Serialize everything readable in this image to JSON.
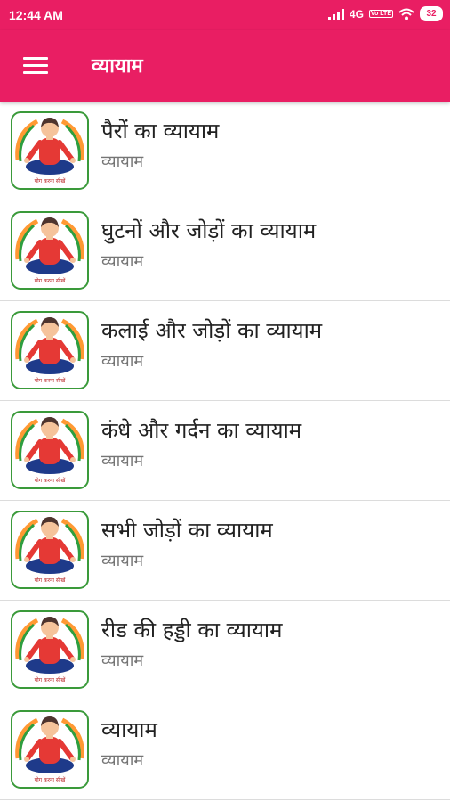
{
  "status_bar": {
    "time": "12:44 AM",
    "network": "4G",
    "volte": "Vo LTE",
    "battery": "32"
  },
  "app_bar": {
    "menu_icon": "hamburger-menu-icon",
    "title": "व्यायाम"
  },
  "thumbnail": {
    "caption": "योग करना सीखें",
    "icon": "yoga-pose-icon"
  },
  "items": [
    {
      "title": "पैरों का व्यायाम",
      "subtitle": "व्यायाम"
    },
    {
      "title": "घुटनों और जोड़ों का व्यायाम",
      "subtitle": "व्यायाम"
    },
    {
      "title": "कलाई और जोड़ों का व्यायाम",
      "subtitle": "व्यायाम"
    },
    {
      "title": "कंधे और गर्दन का व्यायाम",
      "subtitle": "व्यायाम"
    },
    {
      "title": "सभी जोड़ों का व्यायाम",
      "subtitle": "व्यायाम"
    },
    {
      "title": "रीड की हड्डी का व्यायाम",
      "subtitle": "व्यायाम"
    },
    {
      "title": "व्यायाम",
      "subtitle": "व्यायाम"
    }
  ],
  "colors": {
    "primary": "#e91e63",
    "text": "#212121",
    "subtext": "#757575"
  }
}
